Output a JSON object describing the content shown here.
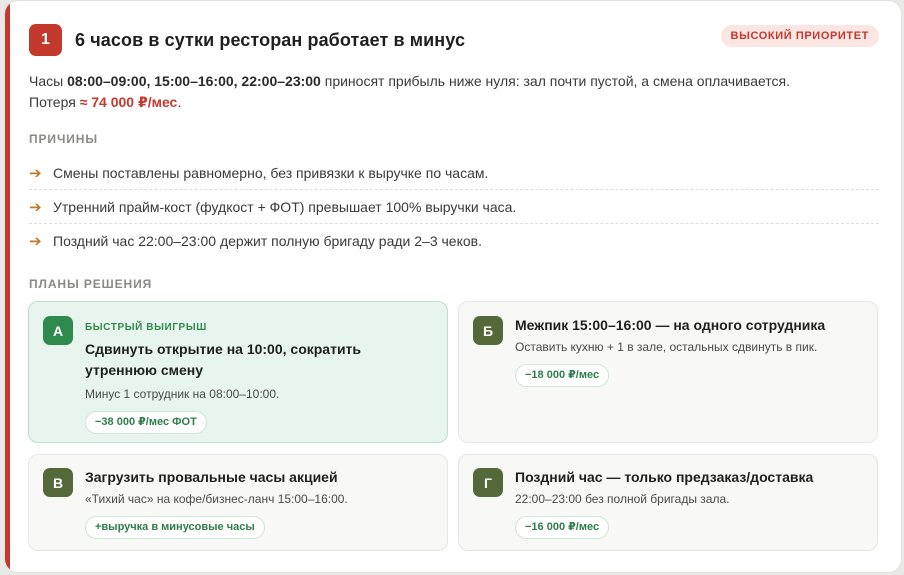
{
  "card": {
    "number": "1",
    "title": "6 часов в сутки ресторан работает в минус",
    "priority": "ВЫСОКИЙ ПРИОРИТЕТ",
    "desc": {
      "prefix": "Часы ",
      "hours": "08:00–09:00, 15:00–16:00, 22:00–23:00",
      "middle": " приносят прибыль ниже нуля: зал почти пустой, а смена оплачивается.",
      "loss_prefix": "Потеря ",
      "loss_value": "≈ 74 000 ₽/мес",
      "loss_suffix": "."
    }
  },
  "causes": {
    "title": "ПРИЧИНЫ",
    "items": [
      "Смены поставлены равномерно, без привязки к выручке по часам.",
      "Утренний прайм-кост (фудкост + ФОТ) превышает 100% выручки часа.",
      "Поздний час 22:00–23:00 держит полную бригаду ради 2–3 чеков."
    ]
  },
  "plans": {
    "title": "ПЛАНЫ РЕШЕНИЯ",
    "items": [
      {
        "letter": "А",
        "kicker": "БЫСТРЫЙ ВЫИГРЫШ",
        "title": "Сдвинуть открытие на 10:00, сократить утреннюю смену",
        "desc": "Минус 1 сотрудник на 08:00–10:00.",
        "pill": "−38 000 ₽/мес ФОТ"
      },
      {
        "letter": "Б",
        "title": "Межпик 15:00–16:00 — на одного сотрудника",
        "desc": "Оставить кухню + 1 в зале, остальных сдвинуть в пик.",
        "pill": "−18 000 ₽/мес"
      },
      {
        "letter": "В",
        "title": "Загрузить провальные часы акцией",
        "desc": "«Тихий час» на кофе/бизнес-ланч 15:00–16:00.",
        "pill": "+выручка в минусовые часы"
      },
      {
        "letter": "Г",
        "title": "Поздний час — только предзаказ/доставка",
        "desc": "22:00–23:00 без полной бригады зала.",
        "pill": "−16 000 ₽/мес"
      }
    ]
  },
  "colors": {
    "accent": "#c3392e",
    "plan_letter": "#55683a",
    "featured_letter": "#2f8a4e",
    "featured_bg": "#e8f5ee",
    "pill_text": "#2e7d4c",
    "cause_arrow": "#c07a2c"
  },
  "icons": {
    "cause_bullet": "arrow-right-icon"
  }
}
